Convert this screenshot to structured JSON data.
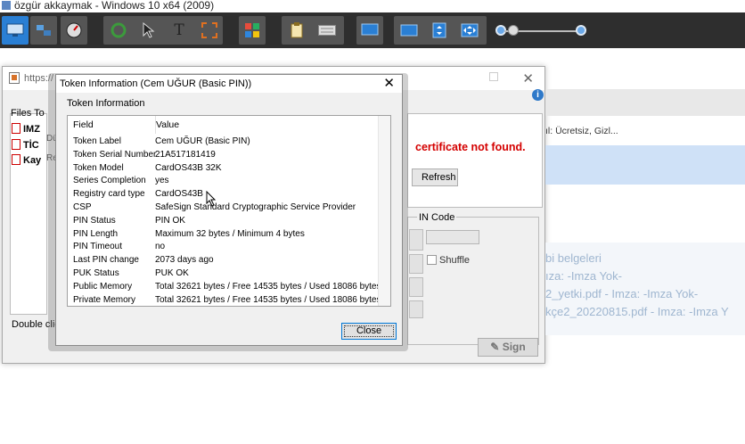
{
  "window_title": "özgür akkaymak - Windows 10 x64 (2009)",
  "toolbar": {
    "buttons": [
      "monitor-icon",
      "network-icon",
      "dashboard-icon",
      "refresh-icon",
      "pointer-icon",
      "text-icon",
      "fullscreen-icon",
      "apps-icon",
      "clipboard-icon",
      "keyboard-icon",
      "screen-icon",
      "window-icon",
      "fit-icon",
      "stretch-icon"
    ],
    "zoom_out_icon": "zoom-out-icon",
    "zoom_in_icon": "zoom-in-icon"
  },
  "background_window": {
    "url": "https://",
    "files_label": "Files To",
    "files": [
      "IMZ",
      "TİC",
      "Kay"
    ],
    "side_labels": [
      "Dü",
      "Re"
    ],
    "error_text": "certificate not found.",
    "refresh_label": "Refresh",
    "pin_code_label": "IN Code",
    "shuffle_label": "Shuffle",
    "sign_label": "Sign",
    "double_click_text": "Double click"
  },
  "right_strip": {
    "line1": "ıl: Ücretsiz, Gizl...",
    "faded": [
      "bi belgeleri",
      "ıza: -Imza Yok-",
      "2_yetki.pdf - Imza: -Imza Yok-",
      "kçe2_20220815.pdf - Imza: -Imza Y"
    ]
  },
  "dialog": {
    "title": "Token Information (Cem UĞUR (Basic PIN))",
    "subtitle": "Token Information",
    "headers": {
      "field": "Field",
      "value": "Value"
    },
    "rows": [
      {
        "field": "Token Label",
        "value": "Cem UĞUR (Basic PIN)"
      },
      {
        "field": "Token Serial Number",
        "value": "21A517181419"
      },
      {
        "field": "Token Model",
        "value": "CardOS43B 32K"
      },
      {
        "field": "Series Completion",
        "value": "yes"
      },
      {
        "field": "Registry card type",
        "value": "CardOS43B"
      },
      {
        "field": "CSP",
        "value": "SafeSign Standard Cryptographic Service Provider"
      },
      {
        "field": "PIN Status",
        "value": "PIN OK"
      },
      {
        "field": "PIN Length",
        "value": "Maximum 32 bytes / Minimum 4 bytes"
      },
      {
        "field": "PIN Timeout",
        "value": "no"
      },
      {
        "field": "Last PIN change",
        "value": "2073 days ago"
      },
      {
        "field": "PUK Status",
        "value": "PUK OK"
      },
      {
        "field": "Public Memory",
        "value": "Total 32621 bytes / Free 14535 bytes / Used 18086 bytes"
      },
      {
        "field": "Private Memory",
        "value": "Total 32621 bytes / Free 14535 bytes / Used 18086 bytes"
      }
    ],
    "close_label": "Close"
  }
}
